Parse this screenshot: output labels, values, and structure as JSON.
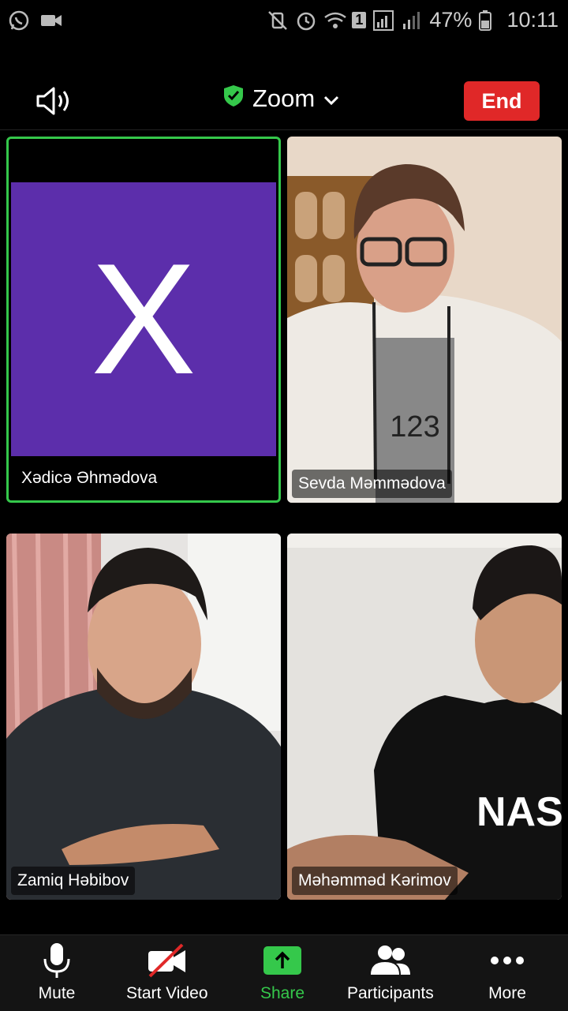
{
  "status_bar": {
    "battery": "47%",
    "time": "10:11",
    "sim_badge": "1"
  },
  "header": {
    "title": "Zoom",
    "end_label": "End"
  },
  "participants": [
    {
      "name": "Xədicə Əhmədova",
      "initial": "X",
      "avatar_color": "#5c2eab",
      "active_speaker": true
    },
    {
      "name": "Sevda Məmmədova"
    },
    {
      "name": "Zamiq Həbibov"
    },
    {
      "name": "Məhəmməd Kərimov"
    }
  ],
  "toolbar": {
    "mute_label": "Mute",
    "video_label": "Start Video",
    "share_label": "Share",
    "participants_label": "Participants",
    "more_label": "More"
  },
  "colors": {
    "accent_green": "#35c84b",
    "end_red": "#e02828"
  }
}
